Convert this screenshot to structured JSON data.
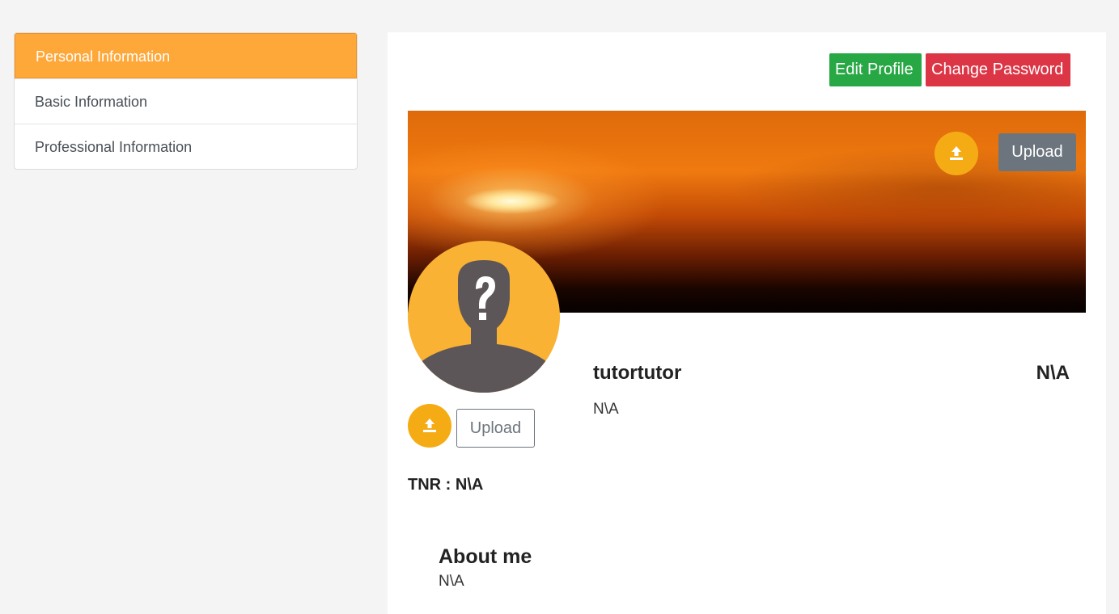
{
  "sidebar": {
    "items": [
      {
        "label": "Personal Information",
        "active": true
      },
      {
        "label": "Basic Information",
        "active": false
      },
      {
        "label": "Professional Information",
        "active": false
      }
    ]
  },
  "actions": {
    "edit_profile": "Edit Profile",
    "change_password": "Change Password"
  },
  "cover": {
    "upload_label": "Upload",
    "upload_icon": "upload-icon"
  },
  "avatar": {
    "icon": "unknown-user-avatar",
    "upload_label": "Upload",
    "upload_icon": "upload-icon"
  },
  "profile": {
    "username": "tutortutor",
    "right_value": "N\\A",
    "subtitle": "N\\A",
    "tnr_label": "TNR : N\\A"
  },
  "about": {
    "title": "About me",
    "text": "N\\A"
  },
  "colors": {
    "accent_orange": "#ffa83a",
    "edit_green": "#28a745",
    "password_red": "#dc3545",
    "upload_gray": "#6c757d",
    "icon_yellow": "#f5ac14"
  }
}
